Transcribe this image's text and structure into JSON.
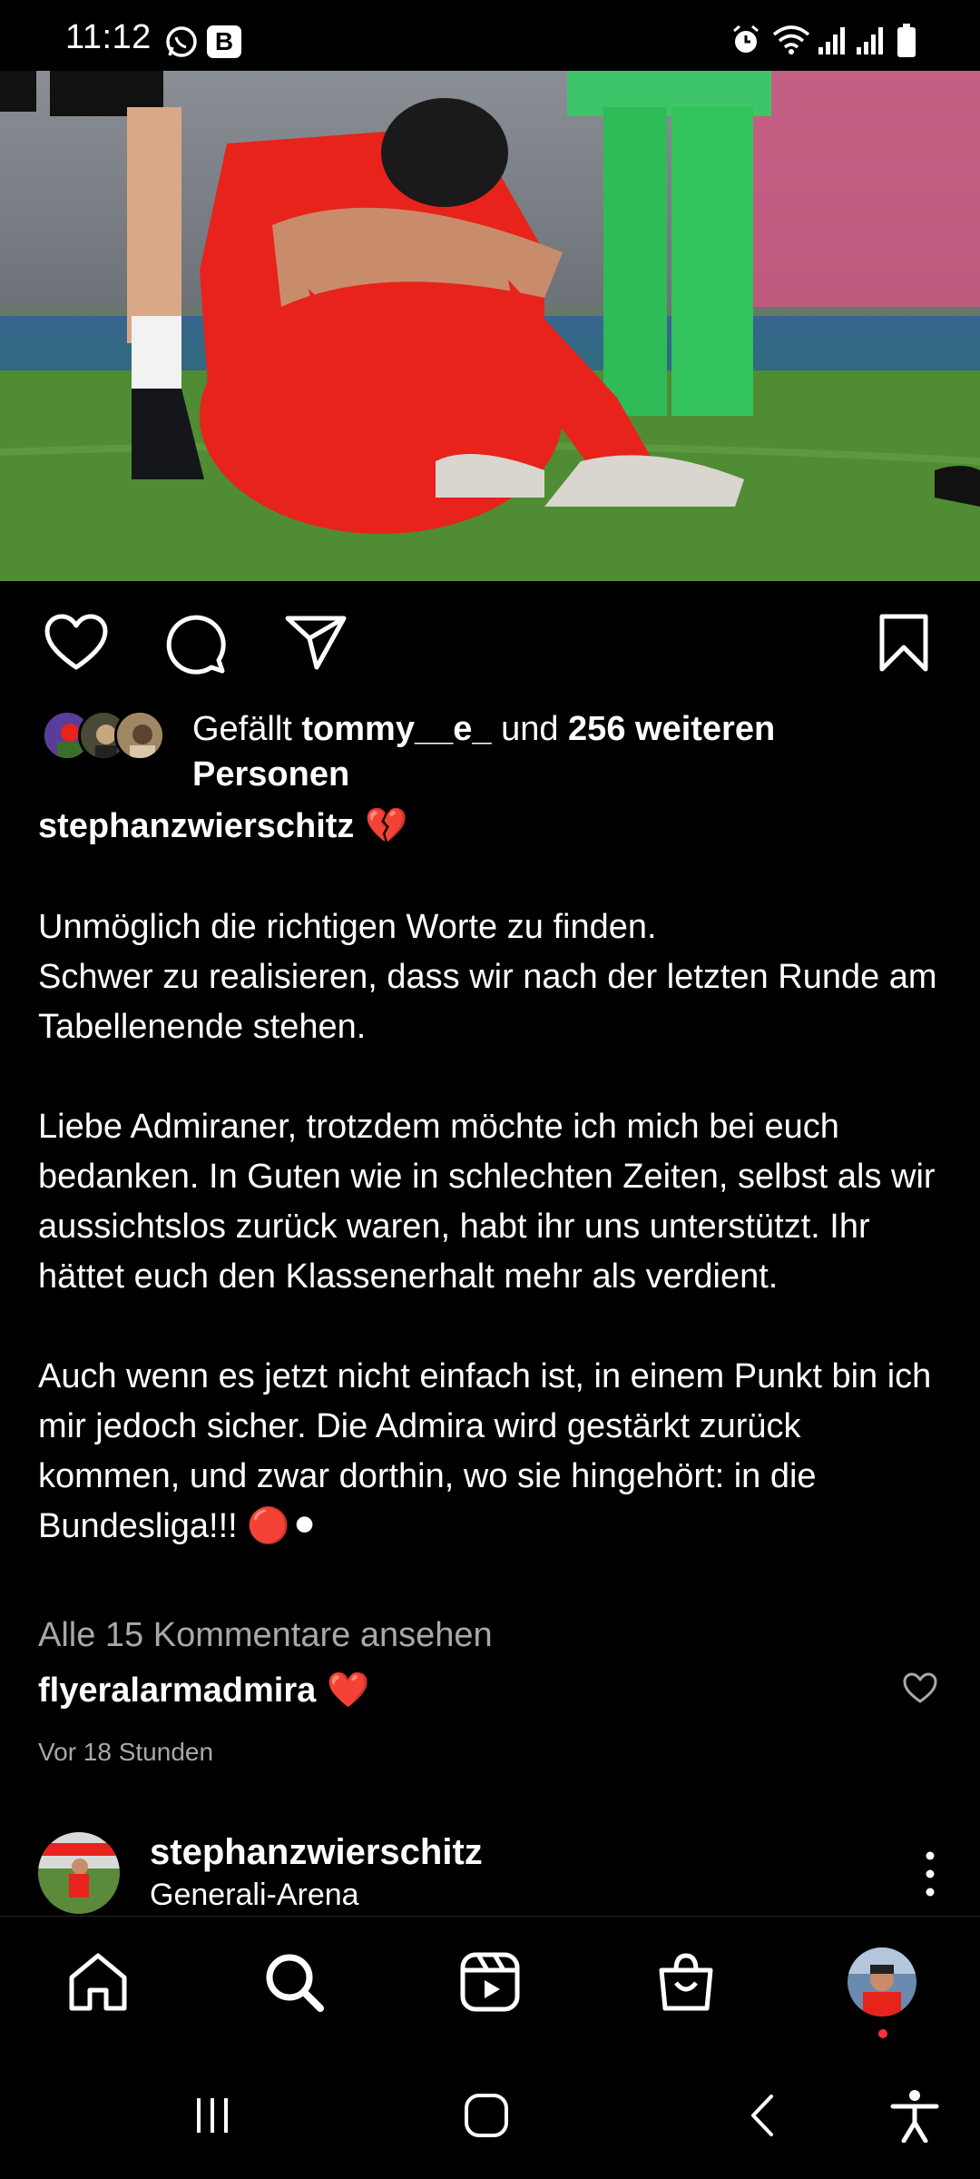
{
  "status_bar": {
    "time": "11:12",
    "left_icons": [
      "whatsapp-icon",
      "b-badge-icon"
    ],
    "right_icons": [
      "alarm-icon",
      "wifi-icon",
      "signal-icon",
      "signal-icon",
      "battery-icon"
    ],
    "badge_letter": "B"
  },
  "post": {
    "image_description": "soccer-player-photo",
    "likes": {
      "prefix": "Gefällt ",
      "user": "tommy__e_",
      "middle": " und ",
      "count": "256 weiteren Personen"
    },
    "caption_user": "stephanzwierschitz",
    "caption_emoji": "💔",
    "caption_paragraphs": [
      "Unmöglich die richtigen Worte zu finden.\nSchwer zu realisieren, dass wir nach der letzten Runde am Tabellenende stehen.",
      "Liebe Admiraner, trotzdem möchte ich mich bei euch bedanken. In Guten wie in schlechten Zeiten, selbst als wir aussichtslos zurück waren, habt ihr uns unterstützt. Ihr hättet euch den Klassenerhalt mehr als verdient.",
      "Auch wenn es jetzt nicht einfach ist, in einem Punkt bin ich mir jedoch sicher. Die Admira wird gestärkt zurück kommen, und zwar dorthin, wo sie hingehört: in die Bundesliga!!! 🔴⚫"
    ],
    "view_comments": "Alle 15 Kommentare ansehen",
    "comment": {
      "user": "flyeralarmadmira",
      "text": "❤️"
    },
    "time_ago": "Vor 18 Stunden"
  },
  "next_post": {
    "user": "stephanzwierschitz",
    "location": "Generali-Arena"
  },
  "colors": {
    "background": "#000000",
    "secondary_text": "#a8a8a8",
    "notification_dot": "#ff3040",
    "jersey_red": "#e8231c",
    "pitch_green": "#4e8a33"
  }
}
